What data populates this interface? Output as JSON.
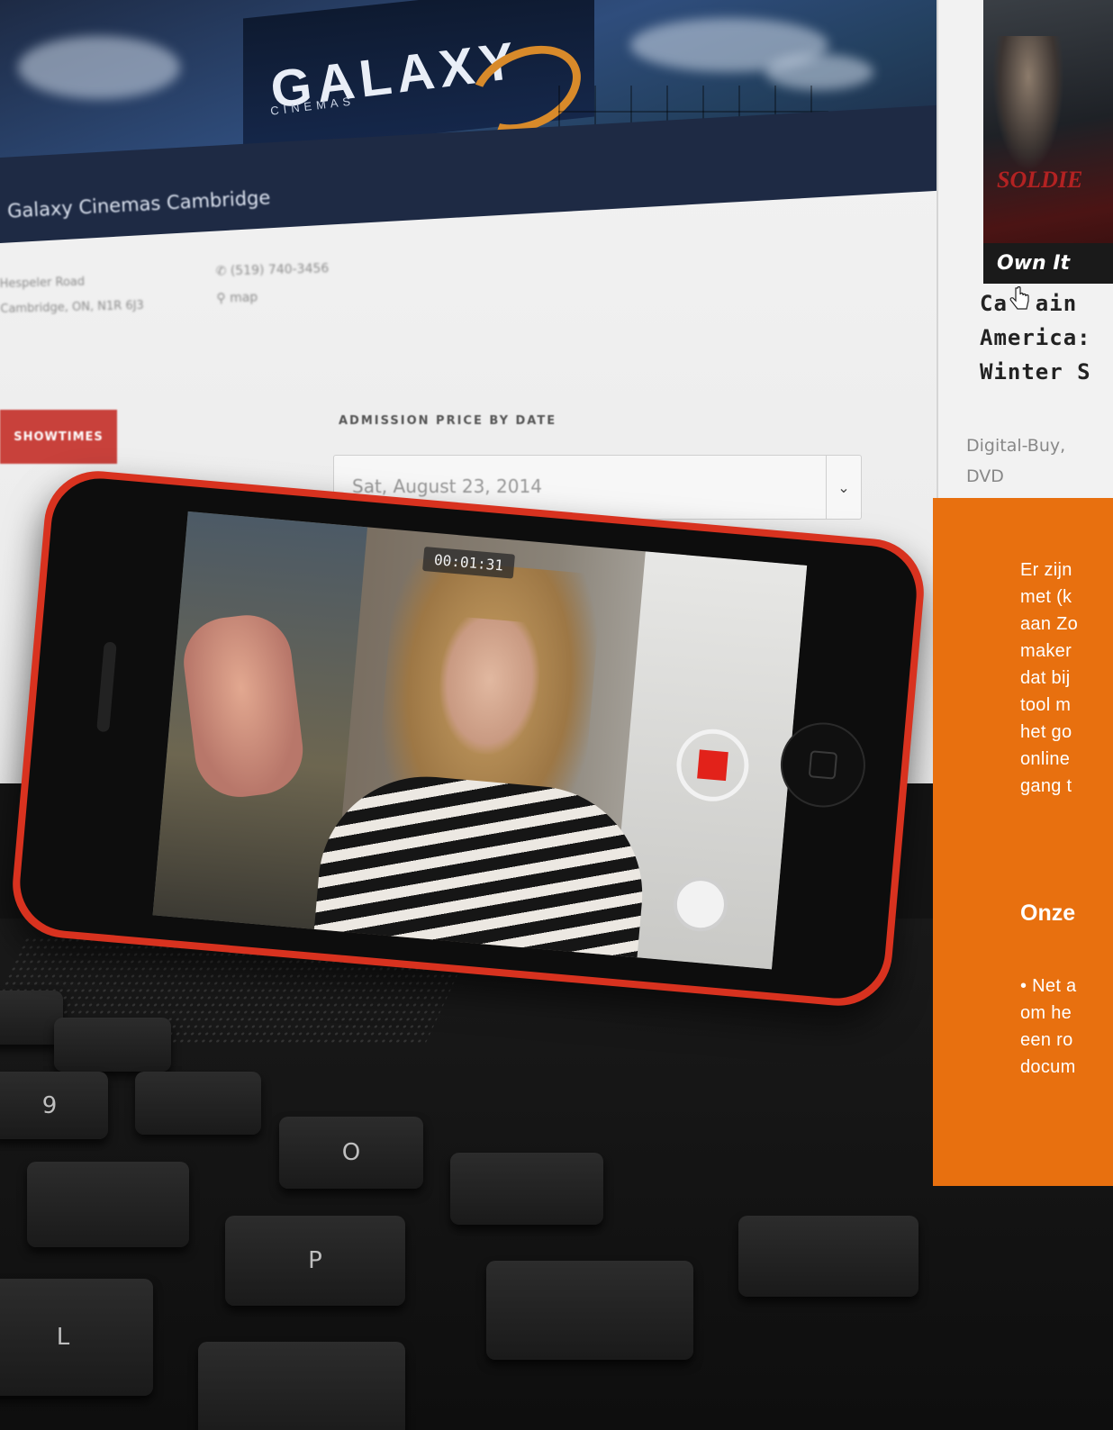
{
  "cinema_site": {
    "logo_text": "GALAXY",
    "logo_subtext": "CINEMAS",
    "theater_name": "Galaxy Cinemas Cambridge",
    "address_line_1": "Hespeler Road",
    "address_line_2": "Cambridge, ON, N1R 6J3",
    "phone": "(519) 740-3456",
    "map_link": "map",
    "showtimes_button": "SHOWTIMES",
    "admission_label": "ADMISSION PRICE BY DATE",
    "selected_date": "Sat, August 23, 2014",
    "dropdown_arrow": "chevron-down-icon"
  },
  "side_panel": {
    "poster_banner": "Own It",
    "poster_title_fragment": "SOLDIE",
    "movie_title_lines": [
      "Ca  ain",
      "America:",
      "Winter S"
    ],
    "formats_lines": [
      "Digital-Buy,",
      "DVD"
    ]
  },
  "phone": {
    "recording_timer": "00:01:31",
    "record_icon": "record-stop-icon",
    "capture_icon": "shutter-icon"
  },
  "orange_card": {
    "paragraph": "Er zijn\nmet (k\naan Zo\nmaker\ndat bij\ntool m\nhet go\nonline\ngang t",
    "heading": "Onze",
    "bullet": "• Net a\nom he\neen ro\ndocum",
    "background_color": "#e8700f"
  },
  "keyboard": {
    "keys": [
      "",
      "",
      "9",
      "",
      "O",
      "",
      "P",
      "",
      "L",
      "",
      "",
      ""
    ]
  }
}
